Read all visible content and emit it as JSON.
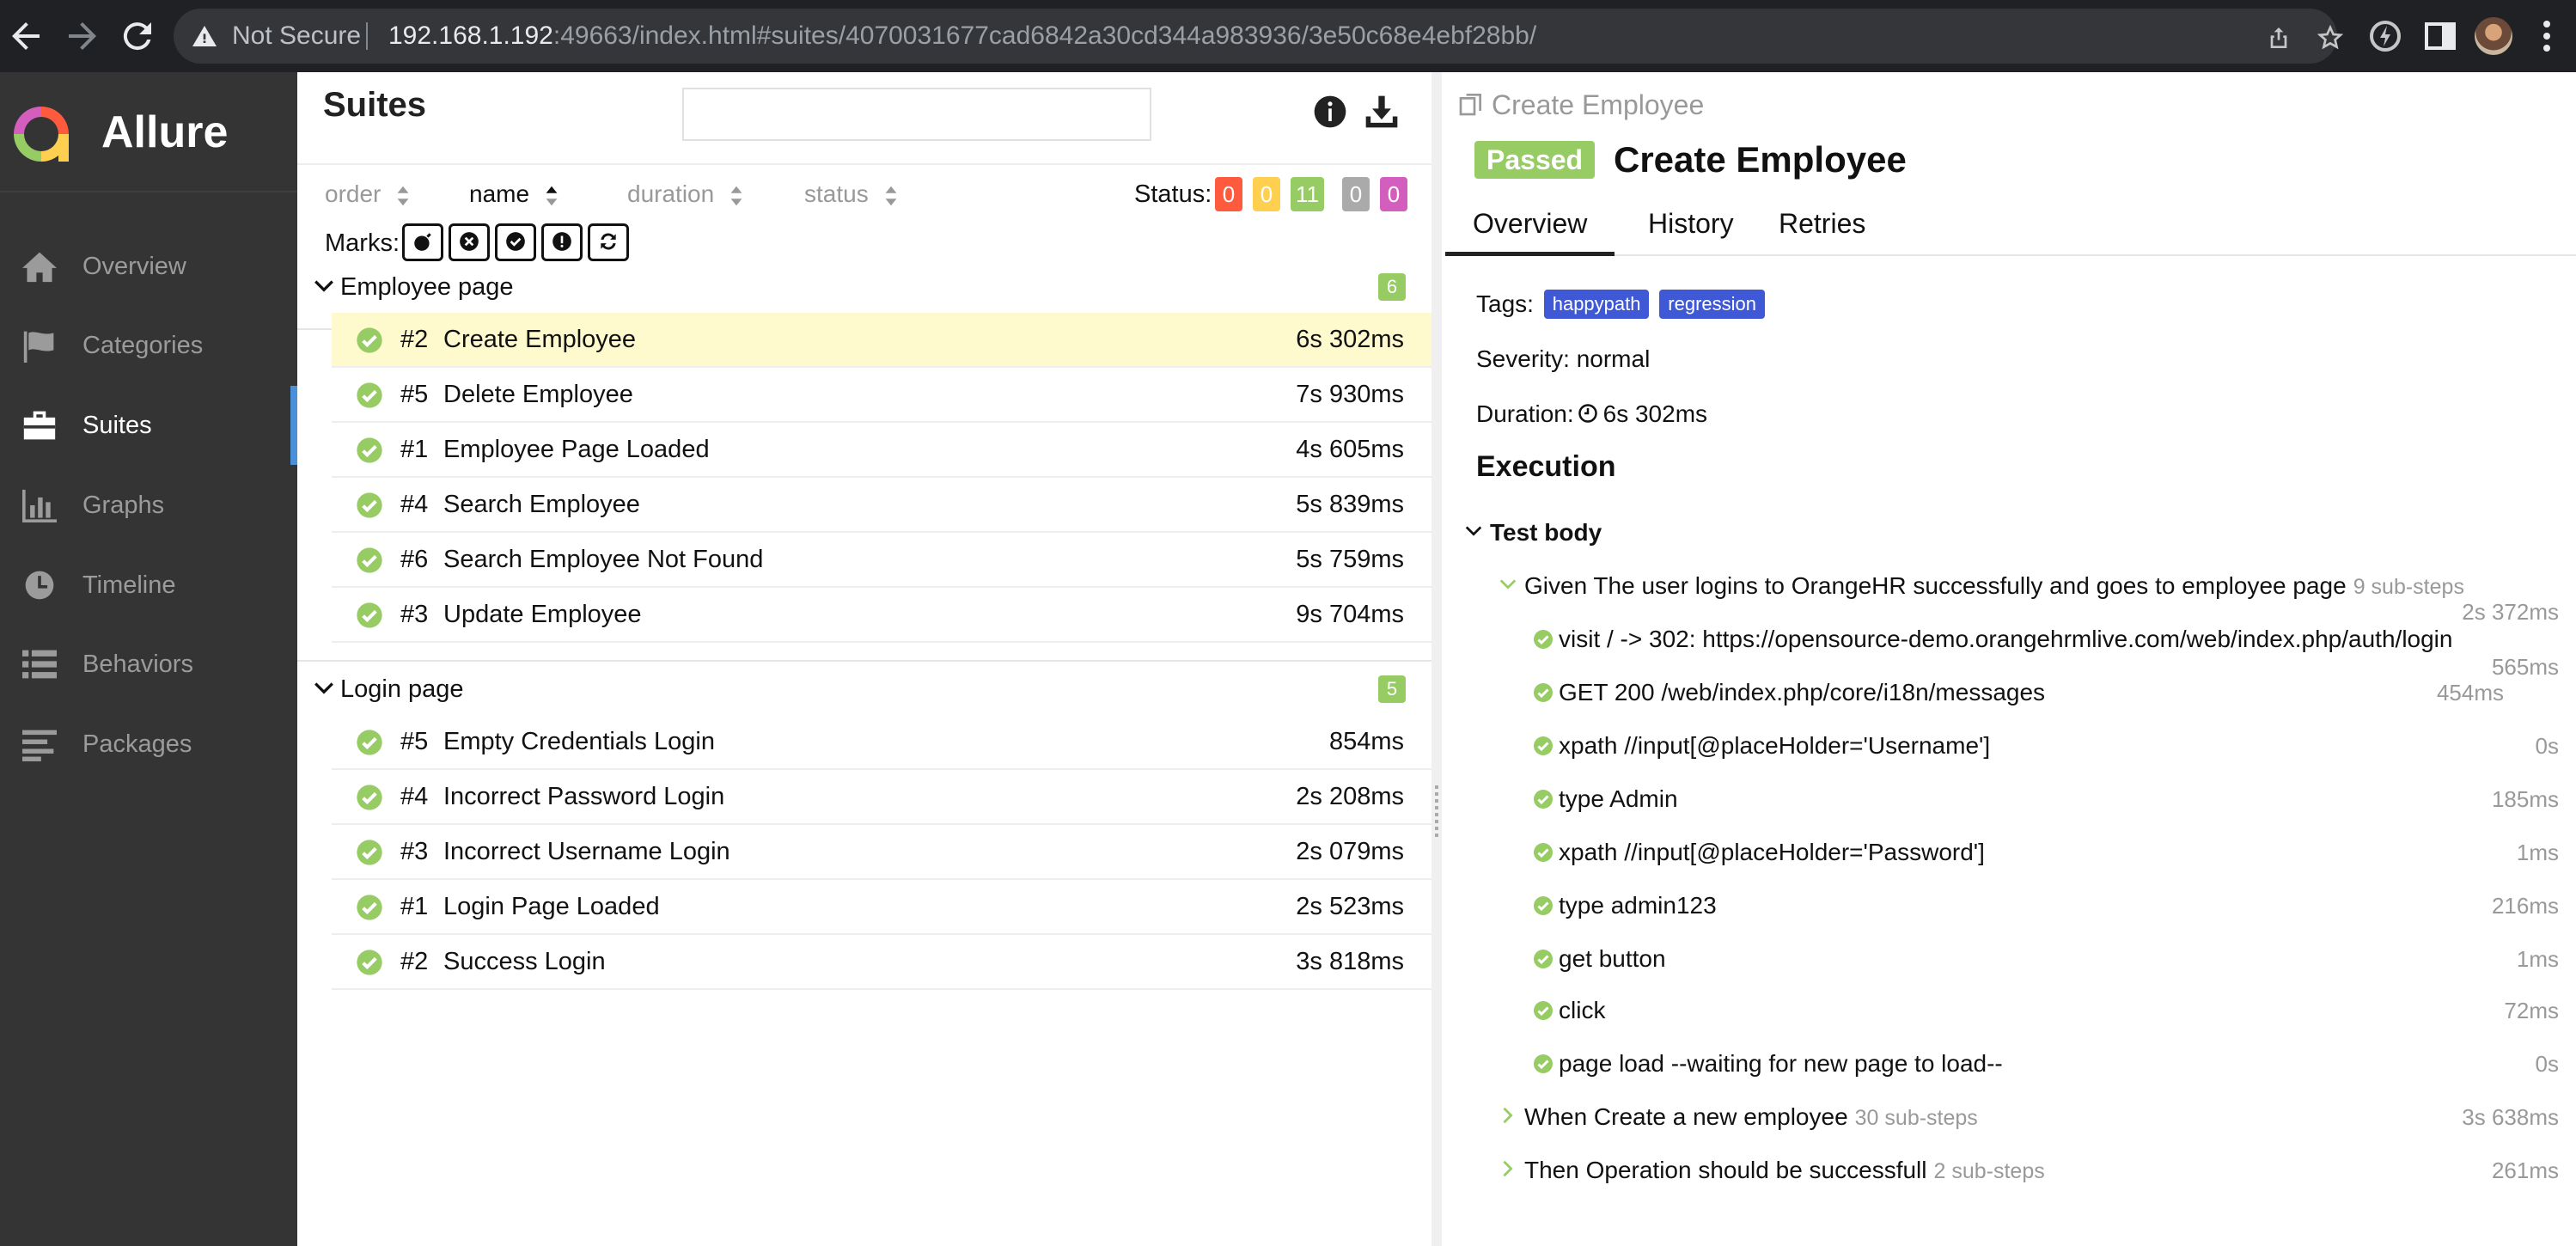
{
  "browser": {
    "security_label": "Not Secure",
    "url_host": "192.168.1.192",
    "url_rest": ":49663/index.html#suites/4070031677cad6842a30cd344a983936/3e50c68e4ebf28bb/"
  },
  "sidebar": {
    "brand": "Allure",
    "items": [
      {
        "label": "Overview",
        "icon": "home-icon"
      },
      {
        "label": "Categories",
        "icon": "flag-icon"
      },
      {
        "label": "Suites",
        "icon": "briefcase-icon",
        "active": true
      },
      {
        "label": "Graphs",
        "icon": "bar-chart-icon"
      },
      {
        "label": "Timeline",
        "icon": "clock-icon"
      },
      {
        "label": "Behaviors",
        "icon": "list-icon"
      },
      {
        "label": "Packages",
        "icon": "align-left-icon"
      }
    ]
  },
  "suites": {
    "title": "Suites",
    "sorters": [
      "order",
      "name",
      "duration",
      "status"
    ],
    "active_sorter": "name",
    "status_label": "Status:",
    "status_counts": [
      {
        "value": "0",
        "color": "#fd5a3e"
      },
      {
        "value": "0",
        "color": "#ffd050"
      },
      {
        "value": "11",
        "color": "#97cc64"
      },
      {
        "value": "0",
        "color": "#aaaaaa"
      },
      {
        "value": "0",
        "color": "#d35ebe"
      }
    ],
    "marks_label": "Marks:",
    "groups": [
      {
        "name": "Employee page",
        "count": "6",
        "rows": [
          {
            "num": "#2",
            "name": "Create Employee",
            "duration": "6s 302ms",
            "selected": true
          },
          {
            "num": "#5",
            "name": "Delete Employee",
            "duration": "7s 930ms"
          },
          {
            "num": "#1",
            "name": "Employee Page Loaded",
            "duration": "4s 605ms"
          },
          {
            "num": "#4",
            "name": "Search Employee",
            "duration": "5s 839ms"
          },
          {
            "num": "#6",
            "name": "Search Employee Not Found",
            "duration": "5s 759ms"
          },
          {
            "num": "#3",
            "name": "Update Employee",
            "duration": "9s 704ms"
          }
        ]
      },
      {
        "name": "Login page",
        "count": "5",
        "rows": [
          {
            "num": "#5",
            "name": "Empty Credentials Login",
            "duration": "854ms"
          },
          {
            "num": "#4",
            "name": "Incorrect Password Login",
            "duration": "2s 208ms"
          },
          {
            "num": "#3",
            "name": "Incorrect Username Login",
            "duration": "2s 079ms"
          },
          {
            "num": "#1",
            "name": "Login Page Loaded",
            "duration": "2s 523ms"
          },
          {
            "num": "#2",
            "name": "Success Login",
            "duration": "3s 818ms"
          }
        ]
      }
    ]
  },
  "detail": {
    "breadcrumb": "Create Employee",
    "status": "Passed",
    "title": "Create Employee",
    "tabs": [
      "Overview",
      "History",
      "Retries"
    ],
    "tags_label": "Tags:",
    "tags": [
      "happypath",
      "regression"
    ],
    "severity": "Severity: normal",
    "duration_label": "Duration:",
    "duration": "6s 302ms",
    "execution_title": "Execution",
    "test_body": "Test body",
    "steps": [
      {
        "name": "Given The user logins to OrangeHR successfully and goes to employee page",
        "sub": "9 sub-steps",
        "time": "2s 372ms",
        "expanded": true,
        "children": [
          {
            "name": "visit / -> 302: https://opensource-demo.orangehrmlive.com/web/index.php/auth/login",
            "time": "565ms"
          },
          {
            "name": "GET 200 /web/index.php/core/i18n/messages",
            "time": "454ms"
          },
          {
            "name": "xpath //input[@placeHolder='Username']",
            "time": "0s"
          },
          {
            "name": "type Admin",
            "time": "185ms"
          },
          {
            "name": "xpath //input[@placeHolder='Password']",
            "time": "1ms"
          },
          {
            "name": "type admin123",
            "time": "216ms"
          },
          {
            "name": "get button",
            "time": "1ms"
          },
          {
            "name": "click",
            "time": "72ms"
          },
          {
            "name": "page load --waiting for new page to load--",
            "time": "0s"
          }
        ]
      },
      {
        "name": "When Create a new employee",
        "sub": "30 sub-steps",
        "time": "3s 638ms"
      },
      {
        "name": "Then Operation should be successfull",
        "sub": "2 sub-steps",
        "time": "261ms"
      }
    ]
  }
}
